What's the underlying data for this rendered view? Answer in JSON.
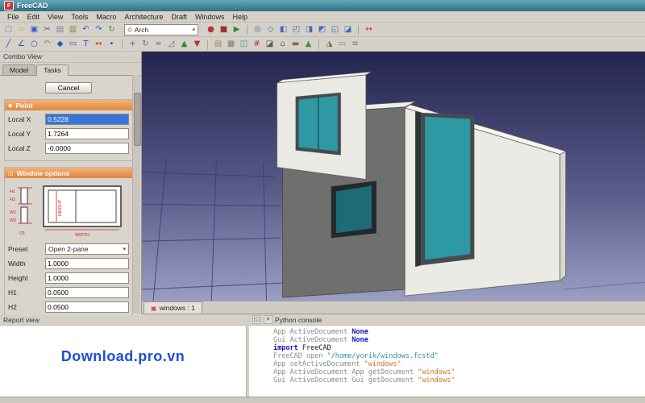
{
  "colors": {
    "titlebar": "#2e7185",
    "section_header_orange": "#e0863f",
    "glass_teal": "#2f99a3",
    "watermark_blue": "#1d4ed8",
    "viewport_gradient_top": "#24244e",
    "viewport_gradient_bottom": "#9a9ec2"
  },
  "titlebar": {
    "title": "FreeCAD"
  },
  "menubar": {
    "items": [
      "File",
      "Edit",
      "View",
      "Tools",
      "Macro",
      "Architecture",
      "Draft",
      "Windows",
      "Help"
    ]
  },
  "toolbars": {
    "workbench_selector": {
      "value": "Arch"
    },
    "row1_left": [
      {
        "name": "document-new",
        "glyph": "▢",
        "color": "#6f87a8"
      },
      {
        "name": "document-open",
        "glyph": "▱",
        "color": "#c89a3a"
      },
      {
        "name": "document-save",
        "glyph": "▣",
        "color": "#3a5ac0"
      },
      {
        "name": "edit-cut",
        "glyph": "✂",
        "color": "#5a5a5a"
      },
      {
        "name": "edit-copy",
        "glyph": "▤",
        "color": "#6f87a8"
      },
      {
        "name": "edit-paste",
        "glyph": "▥",
        "color": "#9a7a4a"
      },
      {
        "name": "edit-undo",
        "glyph": "↶",
        "color": "#3a5ac0"
      },
      {
        "name": "edit-redo",
        "glyph": "↷",
        "color": "#3a5ac0"
      },
      {
        "name": "view-refresh",
        "glyph": "↻",
        "color": "#3a9a4a"
      }
    ],
    "row1_right": [
      {
        "name": "macro-record",
        "glyph": "●",
        "color": "#c03030"
      },
      {
        "name": "macro-stop",
        "glyph": "■",
        "color": "#a03030"
      },
      {
        "name": "macro-run",
        "glyph": "▶",
        "color": "#2a8a2a"
      },
      {
        "sep": true
      },
      {
        "name": "view-fit-all",
        "glyph": "◎",
        "color": "#3a72b8"
      },
      {
        "name": "view-axonometric",
        "glyph": "◇",
        "color": "#3a72b8"
      },
      {
        "name": "view-front",
        "glyph": "◧",
        "color": "#3a72b8"
      },
      {
        "name": "view-top",
        "glyph": "◰",
        "color": "#3a72b8"
      },
      {
        "name": "view-right",
        "glyph": "◨",
        "color": "#3a72b8"
      },
      {
        "name": "view-rear",
        "glyph": "◩",
        "color": "#3a72b8"
      },
      {
        "name": "view-bottom",
        "glyph": "◱",
        "color": "#3a72b8"
      },
      {
        "name": "view-left",
        "glyph": "◪",
        "color": "#3a72b8"
      },
      {
        "sep": true
      },
      {
        "name": "measure-distance",
        "glyph": "↔",
        "color": "#c03030"
      }
    ],
    "row2": [
      {
        "name": "draft-line",
        "glyph": "╱",
        "color": "#2a52c0"
      },
      {
        "name": "draft-wire",
        "glyph": "∠",
        "color": "#2a52c0"
      },
      {
        "name": "draft-circle",
        "glyph": "○",
        "color": "#2a52c0"
      },
      {
        "name": "draft-arc",
        "glyph": "◠",
        "color": "#2a52c0"
      },
      {
        "name": "draft-polygon",
        "glyph": "◆",
        "color": "#2a52c0"
      },
      {
        "name": "draft-rectangle",
        "glyph": "▭",
        "color": "#2a52c0"
      },
      {
        "name": "draft-text",
        "glyph": "T",
        "color": "#2a52c0"
      },
      {
        "name": "draft-dimension",
        "glyph": "↔",
        "color": "#c03030"
      },
      {
        "name": "draft-point",
        "glyph": "•",
        "color": "#2a52c0"
      },
      {
        "sep": true
      },
      {
        "name": "draft-move",
        "glyph": "+",
        "color": "#6a6a6a"
      },
      {
        "name": "draft-rotate",
        "glyph": "↻",
        "color": "#6a6a6a"
      },
      {
        "name": "draft-offset",
        "glyph": "≈",
        "color": "#6a6a6a"
      },
      {
        "name": "draft-trimex",
        "glyph": "◿",
        "color": "#6a6a6a"
      },
      {
        "name": "draft-upgrade",
        "glyph": "▲",
        "color": "#2a8a2a"
      },
      {
        "name": "draft-downgrade",
        "glyph": "▼",
        "color": "#c03030"
      },
      {
        "sep": true
      },
      {
        "name": "arch-wall",
        "glyph": "▤",
        "color": "#a08a58"
      },
      {
        "name": "arch-structure",
        "glyph": "▦",
        "color": "#7a7a7a"
      },
      {
        "name": "arch-window",
        "glyph": "◫",
        "color": "#2f99a3"
      },
      {
        "name": "arch-axis",
        "glyph": "#",
        "color": "#c03030"
      },
      {
        "name": "arch-section-plane",
        "glyph": "◪",
        "color": "#5a5a5a"
      },
      {
        "name": "arch-building",
        "glyph": "⌂",
        "color": "#8a6a4a"
      },
      {
        "name": "arch-floor",
        "glyph": "▬",
        "color": "#8a6a4a"
      },
      {
        "name": "arch-site",
        "glyph": "▲",
        "color": "#4a8a4a"
      },
      {
        "sep": true
      },
      {
        "name": "arch-roof",
        "glyph": "◮",
        "color": "#7a5a3a"
      },
      {
        "name": "arch-panel",
        "glyph": "▭",
        "color": "#7a7a7a"
      },
      {
        "name": "arch-stairs",
        "glyph": "≡",
        "color": "#7a7a7a"
      }
    ]
  },
  "combo_view": {
    "title": "Combo View",
    "tabs": [
      {
        "label": "Model",
        "active": false
      },
      {
        "label": "Tasks",
        "active": true
      }
    ],
    "cancel_label": "Cancel",
    "point": {
      "title": "Point",
      "fields": [
        {
          "label": "Local X",
          "value": "0.5228",
          "selected": true
        },
        {
          "label": "Local Y",
          "value": "1.7264",
          "selected": false
        },
        {
          "label": "Local Z",
          "value": "-0.0000",
          "selected": false
        }
      ]
    },
    "window_options": {
      "title": "Window options",
      "diagram_labels": {
        "h1": "H1",
        "h2": "H2",
        "w1": "W1",
        "w2": "W2",
        "o1": "O1",
        "height": "HEIGHT",
        "width": "WIDTH"
      },
      "preset": {
        "label": "Preset",
        "value": "Open 2-pane"
      },
      "fields": [
        {
          "label": "Width",
          "value": "1.0000",
          "selected": false
        },
        {
          "label": "Height",
          "value": "1.0000",
          "selected": false
        },
        {
          "label": "H1",
          "value": "0.0500",
          "selected": false
        },
        {
          "label": "H2",
          "value": "0.0500",
          "selected": false
        }
      ]
    }
  },
  "viewport": {
    "doc_tab": "windows : 1"
  },
  "report_view": {
    "title": "Report view"
  },
  "python_console": {
    "title": "Python console",
    "lines": [
      [
        {
          "t": "App ActiveDocument ",
          "c": "muted"
        },
        {
          "t": "None",
          "c": "keyword"
        }
      ],
      [
        {
          "t": "Gui ActiveDocument ",
          "c": "muted"
        },
        {
          "t": "None",
          "c": "keyword"
        }
      ],
      [
        {
          "t": "import",
          "c": "keyword"
        },
        {
          "t": " FreeCAD",
          "c": "plain"
        }
      ],
      [
        {
          "t": "FreeCAD open ",
          "c": "muted"
        },
        {
          "t": "\"/home/yorik/windows.fcstd\"",
          "c": "string_path"
        }
      ],
      [
        {
          "t": "App setActiveDocument ",
          "c": "muted"
        },
        {
          "t": "\"windows\"",
          "c": "string"
        }
      ],
      [
        {
          "t": "App ActiveDocument App getDocument ",
          "c": "muted"
        },
        {
          "t": "\"windows\"",
          "c": "string"
        }
      ],
      [
        {
          "t": "Gui ActiveDocument Gui getDocument ",
          "c": "muted"
        },
        {
          "t": "\"windows\"",
          "c": "string"
        }
      ]
    ]
  },
  "watermark": "Download.pro.vn"
}
